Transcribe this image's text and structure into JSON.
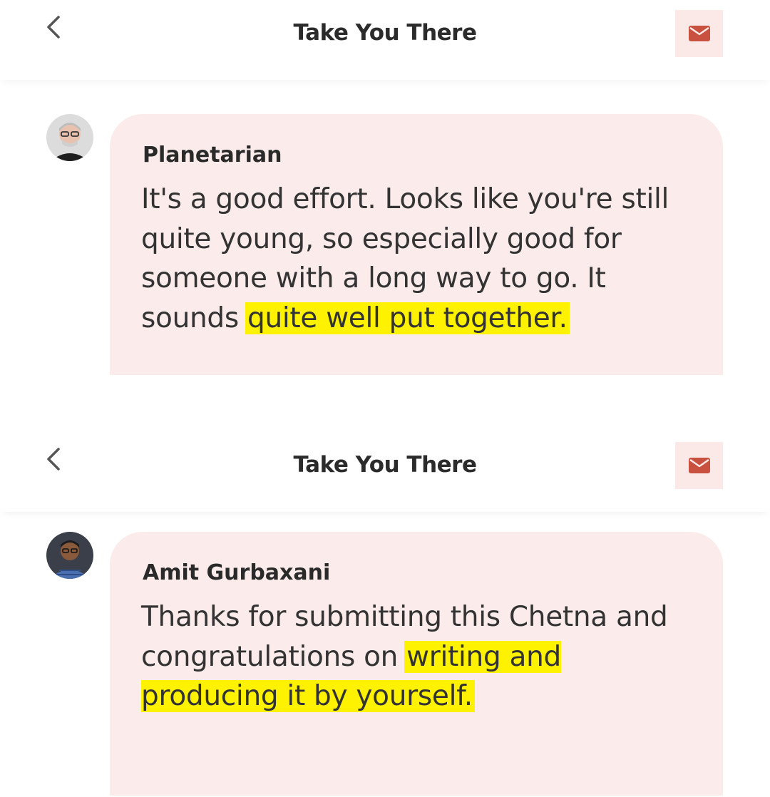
{
  "screens": [
    {
      "header": {
        "title": "Take You There",
        "back_icon": "chevron-left-icon",
        "mail_icon": "envelope-icon"
      },
      "comment": {
        "author": "Planetarian",
        "text_plain": "It's a good effort. Looks like you're still quite young, so especially good for someone with a long way to go. It sounds ",
        "text_highlight": "quite well put together."
      }
    },
    {
      "header": {
        "title": "Take You There",
        "back_icon": "chevron-left-icon",
        "mail_icon": "envelope-icon"
      },
      "comment": {
        "author": "Amit Gurbaxani",
        "text_plain": "Thanks for submitting this Chetna and congratulations on ",
        "text_highlight": "writing and producing it by yourself."
      }
    }
  ],
  "colors": {
    "highlight": "#fff200",
    "bubble": "#fbeceb",
    "mail_button_bg": "#fbe9e7",
    "mail_icon": "#c8523f"
  }
}
